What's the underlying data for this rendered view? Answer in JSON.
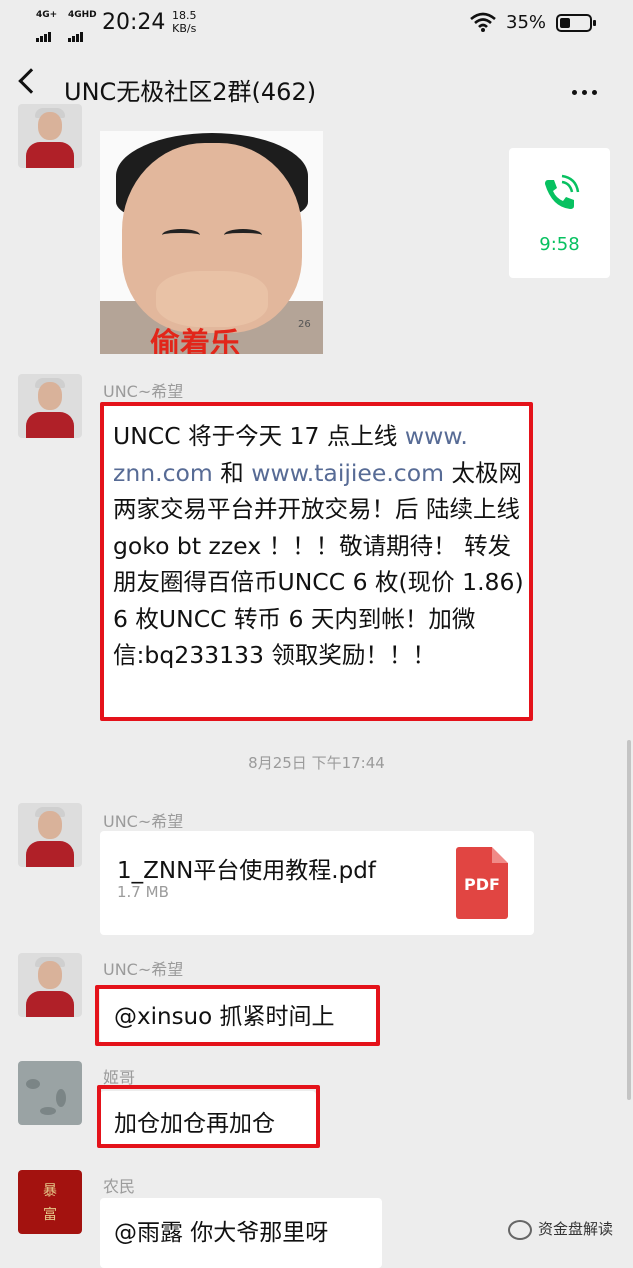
{
  "status_bar": {
    "network1": "4G+",
    "network2": "4GHD",
    "time": "20:24",
    "speed_value": "18.5",
    "speed_unit": "KB/s",
    "battery_pct": "35%",
    "battery_level": 0.35
  },
  "header": {
    "title": "UNC无极社区2群(462)",
    "back_icon": "chevron-left-icon",
    "more_icon": "ellipsis-icon"
  },
  "messages": {
    "m1": {
      "sender": "UNC~希望",
      "sticker_caption": "偷着乐",
      "sticker_number": "26"
    },
    "call": {
      "duration": "9:58",
      "icon": "phone-icon",
      "accent": "#07c160"
    },
    "m2": {
      "sender": "UNC~希望",
      "text_a": "UNCC 将于今天 17 点上线 ",
      "link1": "www.\nznn.com",
      "text_b": " 和 ",
      "link2": "www.taijiee.com",
      "text_c": " 太极网 两家交易平台并开放交易！后 陆续上线 goko bt zzex ！！！敬请期待！ 转发朋友圈得百倍币UNCC 6 枚(现价 1.86) 6 枚UNCC 转币 6 天内到帐！加微信:bq233133 领取奖励！！！"
    },
    "timestamp": "8月25日 下午17:44",
    "m3": {
      "sender": "UNC~希望",
      "file_name": "1_ZNN平台使用教程.pdf",
      "file_size": "1.7 MB",
      "file_badge": "PDF"
    },
    "m4": {
      "sender": "UNC~希望",
      "text": "@xinsuo  抓紧时间上"
    },
    "m5": {
      "sender": "姬哥",
      "text": "加仓加仓再加仓"
    },
    "m6": {
      "sender": "农民",
      "avatar_text_1": "暴",
      "avatar_text_2": "富",
      "text": "@雨露  你大爷那里呀"
    }
  },
  "watermark": {
    "text": "资金盘解读"
  },
  "colors": {
    "background": "#ededed",
    "highlight_box": "#e4121a",
    "link": "#576b95"
  }
}
